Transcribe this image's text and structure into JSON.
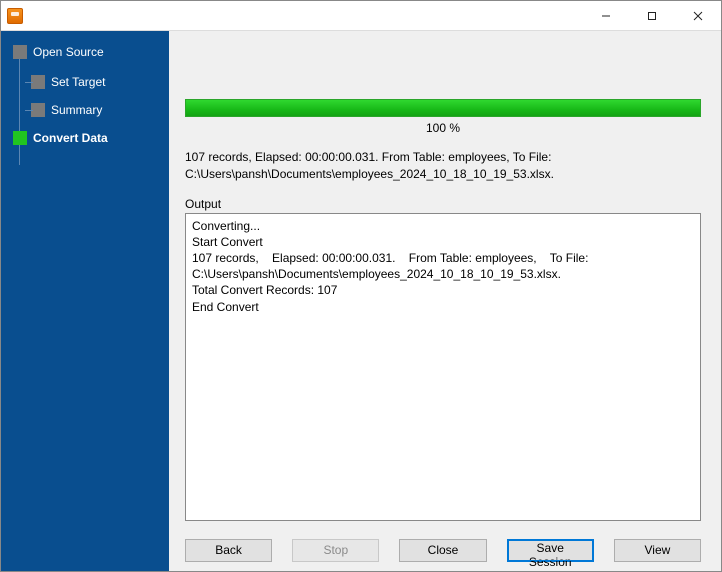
{
  "window": {
    "title": ""
  },
  "sidebar": {
    "items": [
      {
        "label": "Open Source",
        "active": false
      },
      {
        "label": "Set Target",
        "active": false
      },
      {
        "label": "Summary",
        "active": false
      },
      {
        "label": "Convert Data",
        "active": true
      }
    ]
  },
  "progress": {
    "percent_text": "100 %"
  },
  "status": {
    "line1": "107 records,    Elapsed: 00:00:00.031.    From Table: employees,    To File:",
    "line2": "C:\\Users\\pansh\\Documents\\employees_2024_10_18_10_19_53.xlsx."
  },
  "output": {
    "label": "Output",
    "lines": [
      "Converting...",
      "Start Convert",
      "107 records,    Elapsed: 00:00:00.031.    From Table: employees,    To File: C:\\Users\\pansh\\Documents\\employees_2024_10_18_10_19_53.xlsx.",
      "Total Convert Records: 107",
      "End Convert"
    ]
  },
  "buttons": {
    "back": "Back",
    "stop": "Stop",
    "close": "Close",
    "save_session": "Save Session",
    "view": "View"
  }
}
